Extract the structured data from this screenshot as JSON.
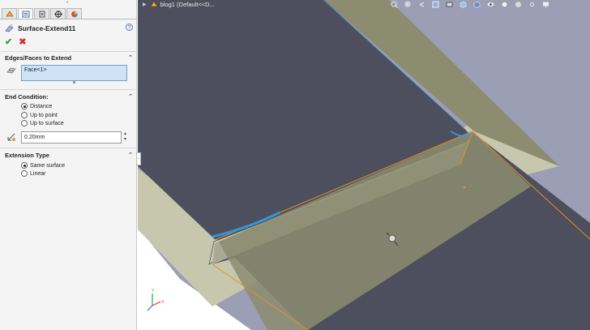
{
  "tabs": [
    {
      "icon": "feature-manager-icon"
    },
    {
      "icon": "property-manager-icon"
    },
    {
      "icon": "configuration-manager-icon"
    },
    {
      "icon": "dimxpert-manager-icon"
    },
    {
      "icon": "display-manager-icon"
    }
  ],
  "feature": {
    "title": "Surface-Extend11",
    "help": "?",
    "ok": "✔",
    "cancel": "✖"
  },
  "sections": {
    "edges": {
      "title": "Edges/Faces to Extend",
      "selection": "Face<1>"
    },
    "end_condition": {
      "title": "End Condition:",
      "options": [
        "Distance",
        "Up to point",
        "Up to surface"
      ],
      "selected": "Distance",
      "distance_value": "0.20mm"
    },
    "extension_type": {
      "title": "Extension Type",
      "options": [
        "Same surface",
        "Linear"
      ],
      "selected": "Same surface"
    }
  },
  "viewport": {
    "breadcrumb": "blog1  (Default<<D...",
    "hud_icons": [
      "zoom-to-fit-icon",
      "zoom-area-icon",
      "previous-view-icon",
      "section-view-icon",
      "dynamic-annotation-icon",
      "view-orientation-icon",
      "display-style-icon",
      "hide-show-icon",
      "edit-appearance-icon",
      "apply-scene-icon",
      "view-settings-icon",
      "monitor-icon"
    ],
    "colors": {
      "background": "#9b9eb4",
      "dark_surface": "#4e4f5e",
      "tan_surface": "#8b8c70",
      "light_surface": "#c7c7ae",
      "edge_highlight": "#e7901f",
      "blue_highlight": "#2b9bea"
    }
  }
}
